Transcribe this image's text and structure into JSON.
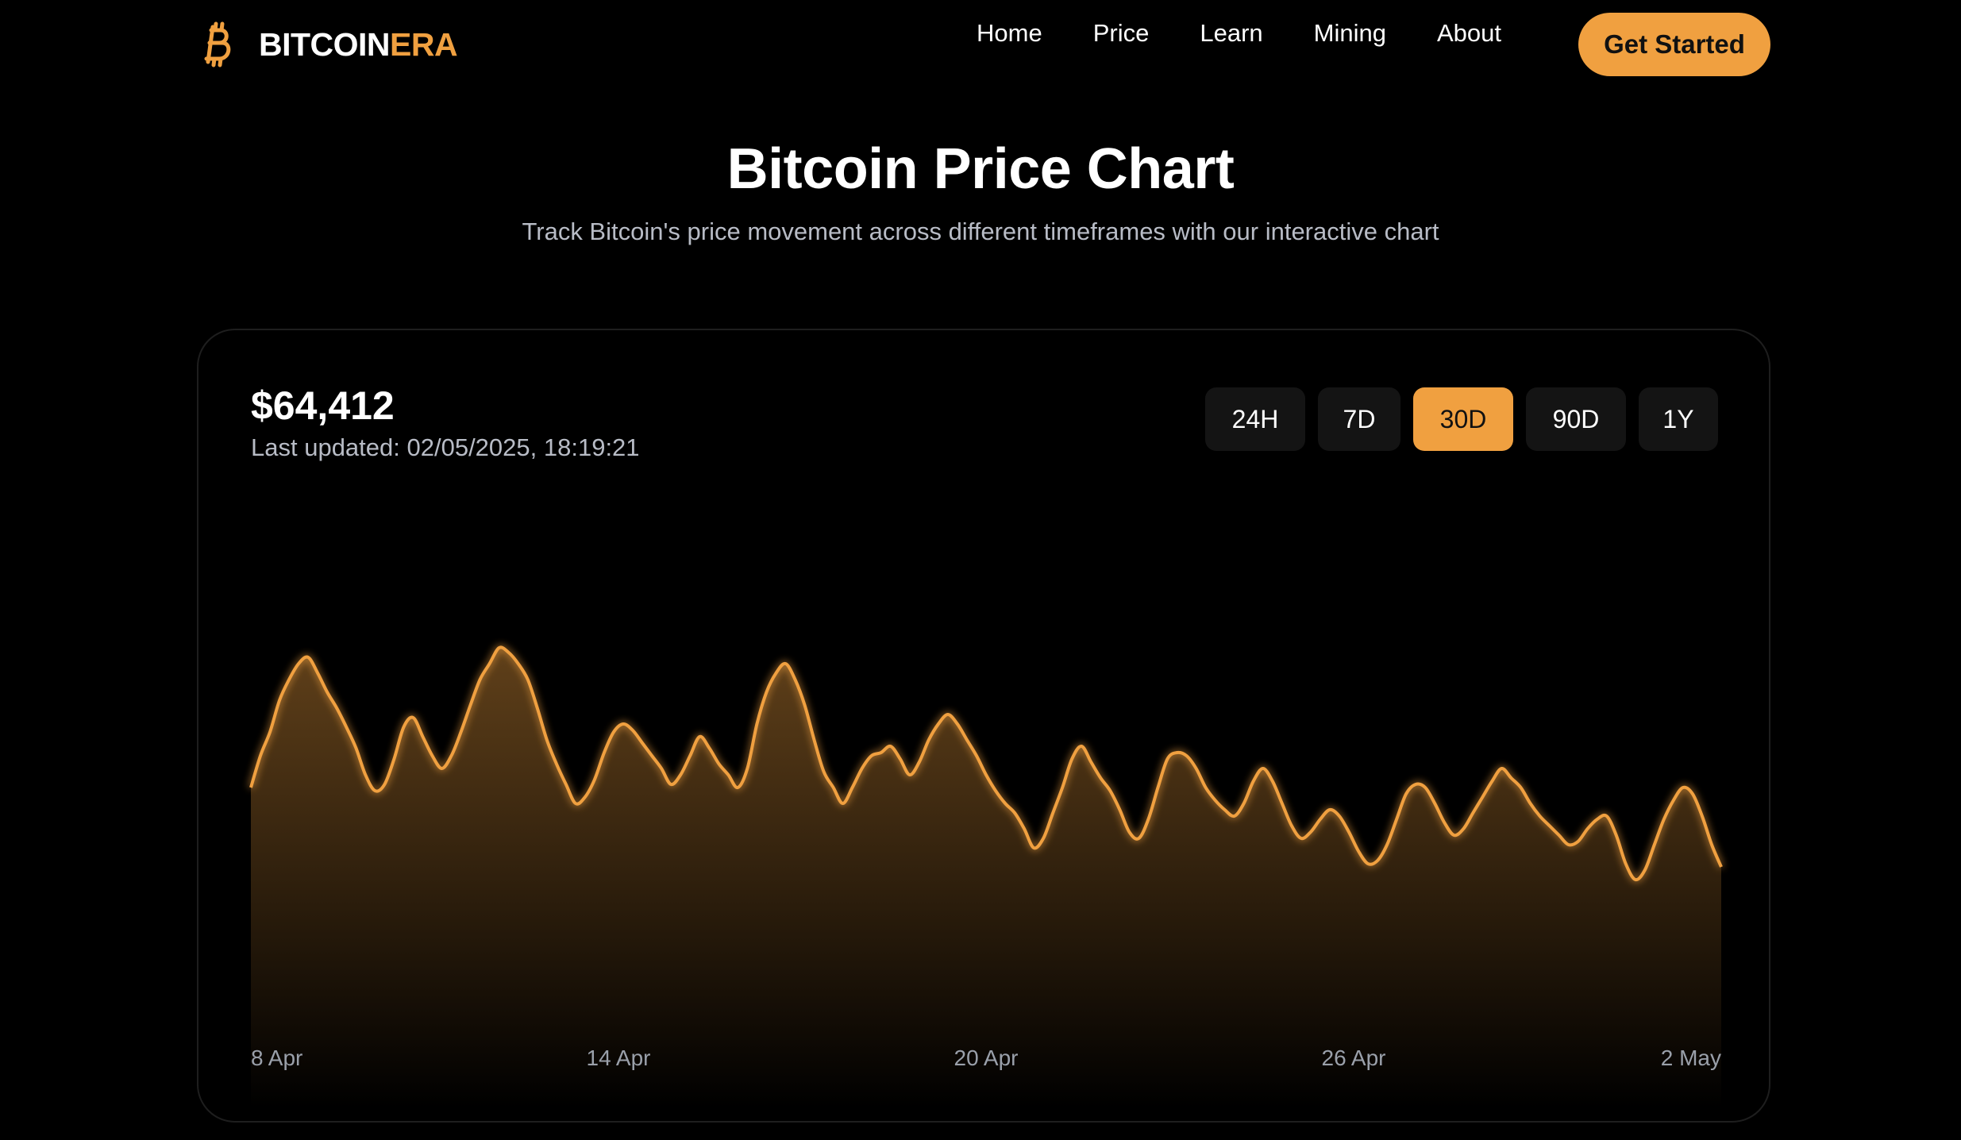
{
  "brand": {
    "name_main": "BITCOIN",
    "name_accent": "ERA",
    "icon": "bitcoin-b-icon",
    "accent_color": "#f0a040"
  },
  "nav": {
    "links": [
      "Home",
      "Price",
      "Learn",
      "Mining",
      "About"
    ],
    "cta_label": "Get Started"
  },
  "hero": {
    "title": "Bitcoin Price Chart",
    "subtitle": "Track Bitcoin's price movement across different timeframes with our interactive chart"
  },
  "card": {
    "price": "$64,412",
    "last_updated": "Last updated: 02/05/2025, 18:19:21",
    "timeframes": [
      "24H",
      "7D",
      "30D",
      "90D",
      "1Y"
    ],
    "active_timeframe": "30D"
  },
  "chart_data": {
    "type": "area",
    "x_tick_labels": [
      "8 Apr",
      "14 Apr",
      "20 Apr",
      "26 Apr",
      "2 May"
    ],
    "values": [
      40,
      60,
      75,
      95,
      108,
      118,
      122,
      112,
      100,
      90,
      78,
      65,
      48,
      38,
      42,
      58,
      78,
      84,
      72,
      60,
      52,
      60,
      75,
      92,
      108,
      118,
      128,
      125,
      118,
      108,
      90,
      70,
      55,
      42,
      30,
      34,
      45,
      62,
      75,
      80,
      76,
      68,
      60,
      52,
      42,
      48,
      60,
      72,
      65,
      55,
      48,
      40,
      52,
      80,
      100,
      112,
      118,
      108,
      92,
      70,
      50,
      40,
      30,
      40,
      52,
      60,
      62,
      66,
      58,
      48,
      56,
      70,
      80,
      86,
      80,
      70,
      60,
      48,
      38,
      30,
      24,
      14,
      2,
      8,
      24,
      40,
      58,
      66,
      56,
      46,
      38,
      26,
      12,
      8,
      20,
      40,
      58,
      62,
      60,
      52,
      40,
      32,
      26,
      22,
      30,
      44,
      52,
      44,
      30,
      16,
      8,
      12,
      20,
      26,
      22,
      12,
      0,
      -8,
      -6,
      4,
      20,
      36,
      42,
      40,
      30,
      18,
      10,
      14,
      24,
      34,
      44,
      52,
      46,
      40,
      30,
      22,
      16,
      10,
      4,
      6,
      14,
      20,
      22,
      10,
      -8,
      -18,
      -12,
      4,
      20,
      32,
      40,
      36,
      22,
      4,
      -10
    ],
    "line_color": "#f0a040",
    "grid": false,
    "legend": false
  }
}
